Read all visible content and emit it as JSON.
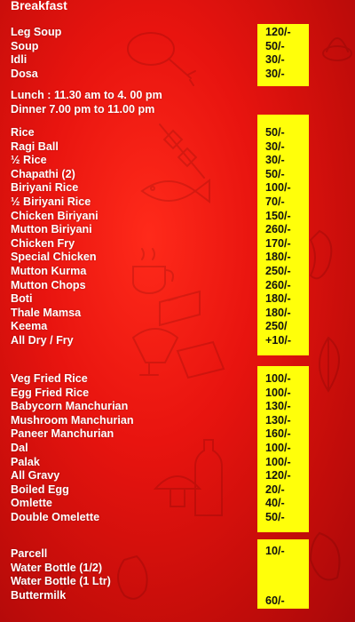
{
  "menu": {
    "title": "Breakfast",
    "breakfast": [
      {
        "name": "Leg Soup",
        "price": "120/-"
      },
      {
        "name": "Soup",
        "price": "50/-"
      },
      {
        "name": "Idli",
        "price": "30/-"
      },
      {
        "name": "Dosa",
        "price": "30/-"
      }
    ],
    "hours": {
      "lunch": "Lunch : 11.30 am to 4. 00 pm",
      "dinner": "Dinner 7.00 pm to 11.00 pm"
    },
    "main": [
      {
        "name": "Rice",
        "price": "50/-"
      },
      {
        "name": "Ragi Ball",
        "price": "30/-"
      },
      {
        "name": "½ Rice",
        "price": "30/-"
      },
      {
        "name": "Chapathi (2)",
        "price": "50/-"
      },
      {
        "name": "Biriyani Rice",
        "price": "100/-"
      },
      {
        "name": "½ Biriyani Rice",
        "price": "70/-"
      },
      {
        "name": "Chicken Biriyani",
        "price": "150/-"
      },
      {
        "name": "Mutton Biriyani",
        "price": "260/-"
      },
      {
        "name": "Chicken Fry",
        "price": "170/-"
      },
      {
        "name": "Special Chicken",
        "price": "180/-"
      },
      {
        "name": "Mutton Kurma",
        "price": "250/-"
      },
      {
        "name": "Mutton Chops",
        "price": "260/-"
      },
      {
        "name": "Boti",
        "price": "180/-"
      },
      {
        "name": "Thale Mamsa",
        "price": "180/-"
      },
      {
        "name": "Keema",
        "price": "250/"
      },
      {
        "name": "All Dry / Fry",
        "price": "+10/-"
      }
    ],
    "chinese": [
      {
        "name": "Veg Fried Rice",
        "price": "100/-"
      },
      {
        "name": "Egg Fried Rice",
        "price": "100/-"
      },
      {
        "name": "Babycorn Manchurian",
        "price": "130/-"
      },
      {
        "name": "Mushroom Manchurian",
        "price": "130/-"
      },
      {
        "name": "Paneer Manchurian",
        "price": "160/-"
      },
      {
        "name": "Dal",
        "price": "100/-"
      },
      {
        "name": "Palak",
        "price": "100/-"
      },
      {
        "name": "All Gravy",
        "price": "120/-"
      },
      {
        "name": "Boiled Egg",
        "price": "20/-"
      },
      {
        "name": "Omlette",
        "price": "40/-"
      },
      {
        "name": "Double Omelette",
        "price": "50/-"
      }
    ],
    "extras": [
      {
        "name": "Parcell",
        "price": "10/-"
      },
      {
        "name": "Water Bottle (1/2)",
        "price": ""
      },
      {
        "name": "Water Bottle (1 Ltr)",
        "price": ""
      },
      {
        "name": "Buttermilk",
        "price": "60/-"
      }
    ]
  },
  "colors": {
    "background": "#e8140f",
    "price_highlight": "#ffff0a",
    "text": "#ffffff",
    "price_text": "#111111"
  }
}
